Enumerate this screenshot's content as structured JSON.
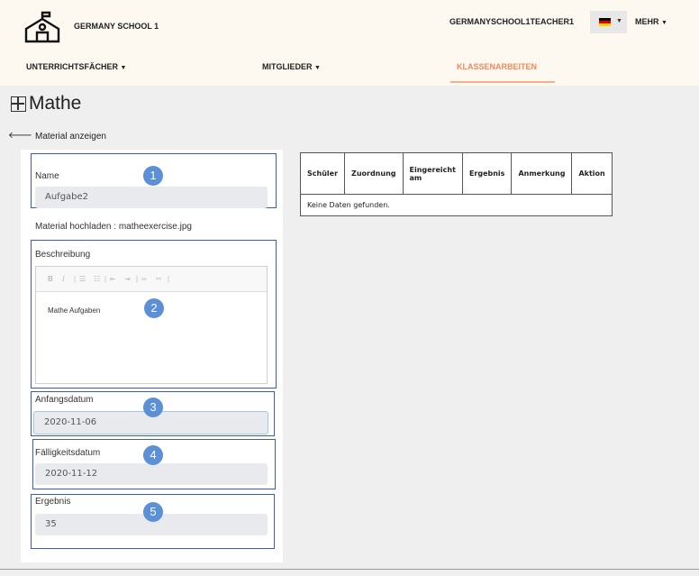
{
  "header": {
    "school_name": "GERMANY SCHOOL 1",
    "username": "GERMANYSCHOOL1TEACHER1",
    "language": "de",
    "more_label": "MEHR",
    "flag_colors": [
      "#000000",
      "#dd0000",
      "#ffce00"
    ]
  },
  "nav": {
    "subjects_label": "UNTERRICHTSFÄCHER",
    "members_label": "MITGLIEDER",
    "exams_label": "KLASSENARBEITEN",
    "active": "KLASSENARBEITEN",
    "active_color": "#f08a5a"
  },
  "page": {
    "title": "Mathe",
    "back_label": "Material anzeigen"
  },
  "form": {
    "name_label": "Name",
    "name_value": "Aufgabe2",
    "upload_text": "Material hochladen : matheexercise.jpg",
    "description_label": "Beschreibung",
    "description_value": "Mathe Aufgaben",
    "start_label": "Anfangsdatum",
    "start_value": "2020-11-06",
    "due_label": "Fälligkeitsdatum",
    "due_value": "2020-11-12",
    "result_label": "Ergebnis",
    "result_value": "35"
  },
  "badges": [
    "1",
    "2",
    "3",
    "4",
    "5"
  ],
  "table": {
    "headers": [
      "Schüler",
      "Zuordnung",
      "Eingereicht am",
      "Ergebnis",
      "Anmerkung",
      "Aktion"
    ],
    "empty_text": "Keine Daten gefunden."
  }
}
